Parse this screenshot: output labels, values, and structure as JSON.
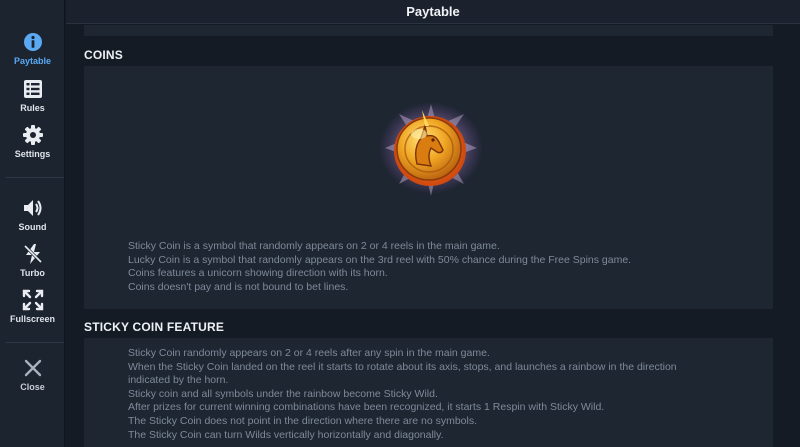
{
  "header": {
    "title": "Paytable"
  },
  "sidebar": {
    "items": [
      {
        "label": "Paytable"
      },
      {
        "label": "Rules"
      },
      {
        "label": "Settings"
      },
      {
        "label": "Sound"
      },
      {
        "label": "Turbo"
      },
      {
        "label": "Fullscreen"
      },
      {
        "label": "Close"
      }
    ]
  },
  "sections": {
    "coins": {
      "title": "COINS",
      "lines": [
        "Sticky Coin is a symbol that randomly appears on 2 or 4 reels in the main game.",
        "Lucky Coin is  a symbol that randomly appears on the 3rd reel with 50% chance during the Free Spins game.",
        "Coins features a unicorn showing direction with its horn.",
        "Coins doesn't pay and is not bound to bet lines."
      ]
    },
    "sticky": {
      "title": "STICKY COIN FEATURE",
      "lines": [
        "Sticky Coin randomly appears on 2 or 4 reels after any spin in the main game.",
        "When the Sticky Coin landed on the reel it starts to rotate about its axis, stops, and launches a rainbow in the direction",
        "indicated by the horn.",
        "Sticky coin and all symbols under the rainbow become Sticky Wild.",
        "After prizes for current winning combinations have been recognized, it starts 1 Respin with Sticky Wild.",
        "The Sticky Coin does not point in the direction where there are no symbols.",
        "The Sticky Coin can turn Wilds vertically horizontally and diagonally."
      ]
    }
  },
  "colors": {
    "accent": "#5aa9f2",
    "coin_gold": "#e8a21e"
  }
}
